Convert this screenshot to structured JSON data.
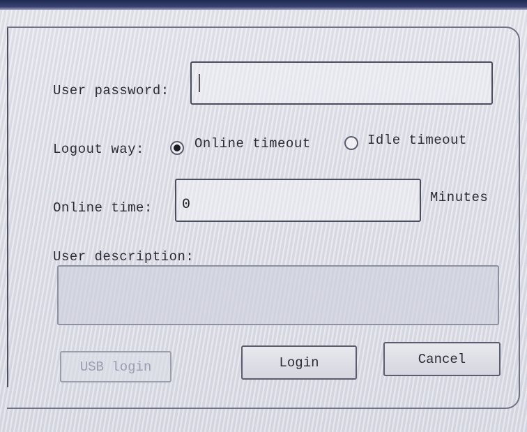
{
  "form": {
    "password_label": "User password:",
    "password_value": "",
    "logout_label": "Logout way:",
    "logout_options": [
      {
        "label": "Online timeout",
        "selected": true
      },
      {
        "label": "Idle timeout",
        "selected": false
      }
    ],
    "online_time_label": "Online time:",
    "online_time_value": "0",
    "online_time_unit": "Minutes",
    "description_label": "User description:",
    "description_value": ""
  },
  "buttons": {
    "usb_login": "USB login",
    "login": "Login",
    "cancel": "Cancel"
  }
}
